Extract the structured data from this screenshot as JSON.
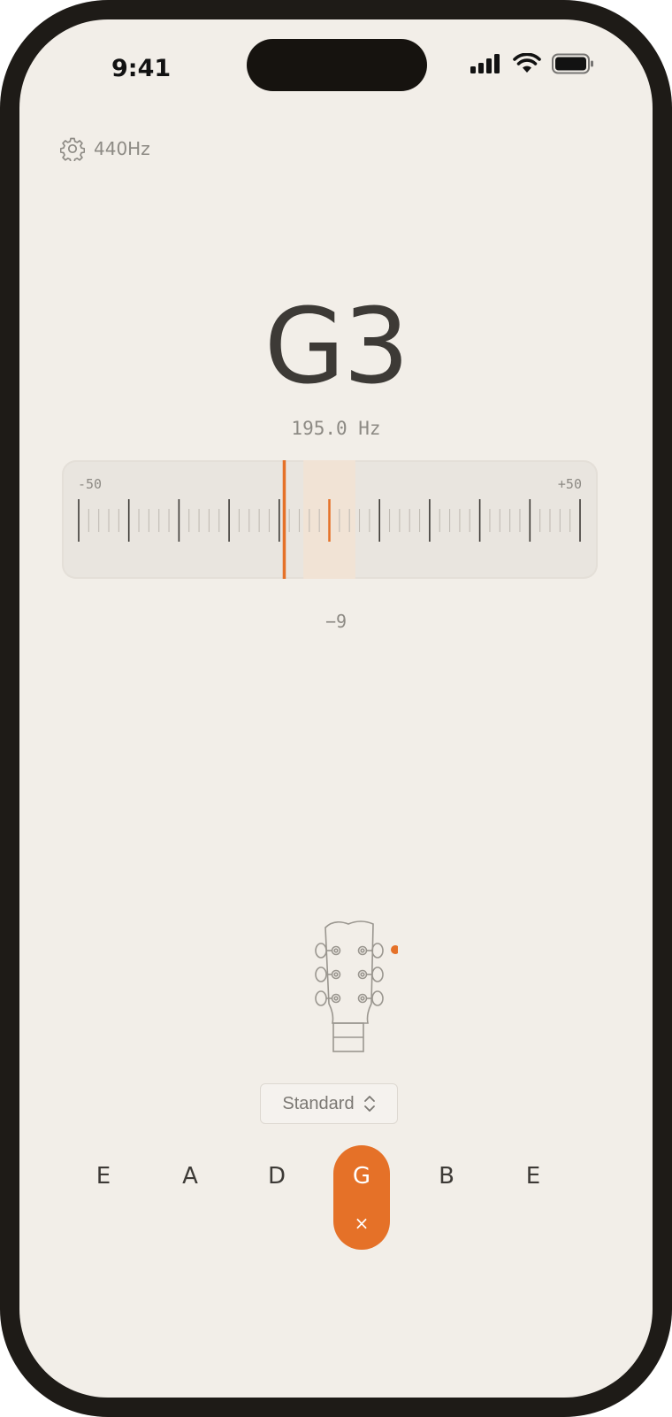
{
  "status_bar": {
    "time": "9:41"
  },
  "settings": {
    "icon": "gear-icon",
    "reference_label": "440Hz"
  },
  "tuner": {
    "note": "G3",
    "frequency": "195.0 Hz",
    "meter": {
      "min_label": "-50",
      "max_label": "+50",
      "cents_value": -9,
      "in_tune_range": [
        -5,
        5
      ]
    },
    "cents_display": "−9"
  },
  "tuning_selector": {
    "value": "Standard",
    "icon": "chevron-up-down-icon"
  },
  "strings": [
    {
      "label": "E",
      "active": false
    },
    {
      "label": "A",
      "active": false
    },
    {
      "label": "D",
      "active": false
    },
    {
      "label": "G",
      "active": true,
      "dismiss_icon": "close-icon",
      "dismiss_glyph": "×"
    },
    {
      "label": "B",
      "active": false
    },
    {
      "label": "E",
      "active": false
    }
  ],
  "colors": {
    "accent": "#e57128",
    "background": "#f2eee8",
    "text": "#3d3a36",
    "muted": "#8d8a84"
  }
}
